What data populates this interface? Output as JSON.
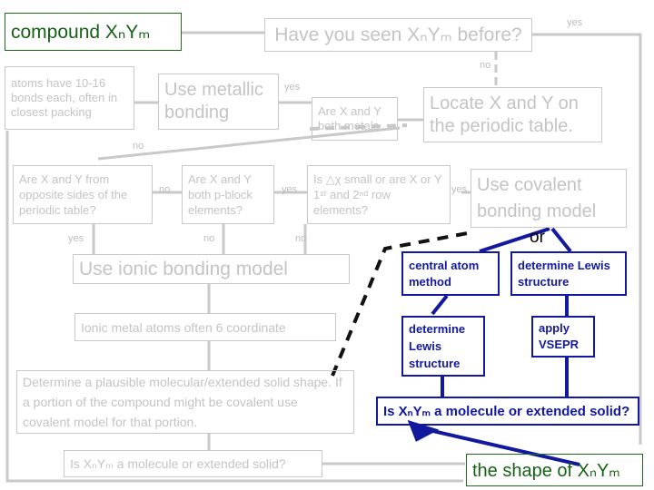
{
  "colors": {
    "gray_line": "#c9c9c9",
    "gray_text": "#c4c4c4",
    "green": "#176117",
    "blue": "#13199e",
    "black": "#000000"
  },
  "nodes": {
    "compound": "compound XₙYₘ",
    "have_you_seen": "Have you seen XₙYₘ before?",
    "atoms_have": "atoms have 10-16 bonds each, often in closest packing",
    "use_metallic": "Use metallic bonding",
    "are_both_metals": "Are X and Y both metals",
    "locate_xy": "Locate X and Y on the periodic table.",
    "opposite_sides": "Are X and Y  from opposite sides of the periodic table?",
    "both_p_block": "Are X and Y both p-block elements?",
    "delta_chi": "Is △χ small or are X or Y 1ˢᵗ and 2ⁿᵈ row elements?",
    "use_covalent": "Use  covalent bonding  model",
    "use_ionic": "Use  ionic  bonding   model",
    "ionic_6_coordinate": "Ionic metal atoms often 6 coordinate",
    "determine_plausible": "Determine a plausible molecular/extended solid shape. If a portion of the compound might be covalent use covalent model for that portion.",
    "is_molecule_gray": "Is XₙYₘ a molecule or extended solid?",
    "central_atom_method": "central atom method",
    "determine_lewis_structure_right": "determine Lewis structure",
    "determine_lewis_structure_left": "determine Lewis structure",
    "apply_vsepr": "apply VSEPR",
    "is_molecule_blue": "Is XₙYₘ a molecule or extended solid?",
    "the_shape": "the shape of XₙYₘ",
    "or_label": "or"
  },
  "edge_labels": {
    "yes_top_right": "yes",
    "no_under_have_you_seen": "no",
    "yes_after_metallic": "yes",
    "no_left_diagonal": "no",
    "yes_opposite_sides": "yes",
    "no_opposite_sides": "no",
    "no_p_block": "no",
    "yes_p_block": "yes",
    "no_delta_chi": "no",
    "yes_delta_chi": "yes"
  }
}
